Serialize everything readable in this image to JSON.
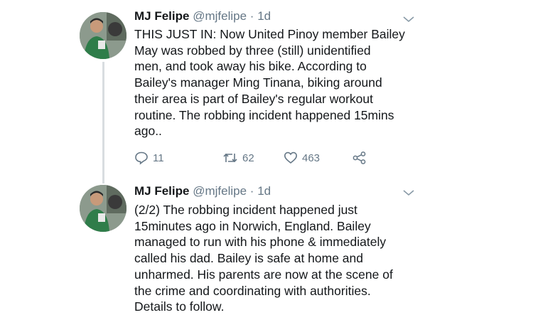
{
  "tweets": [
    {
      "author": {
        "name": "MJ Felipe",
        "handle": "@mjfelipe"
      },
      "separator": "·",
      "time": "1d",
      "text": "THIS JUST IN: Now United Pinoy member Bailey\nMay was robbed by three (still) unidentified\nmen, and took away his bike. According to\nBailey's manager Ming Tinana, biking around\ntheir area is part of Bailey's regular workout\nroutine. The robbing incident happened 15mins\nago..",
      "replies": "11",
      "retweets": "62",
      "likes": "463"
    },
    {
      "author": {
        "name": "MJ Felipe",
        "handle": "@mjfelipe"
      },
      "separator": "·",
      "time": "1d",
      "text": "(2/2) The robbing incident happened just\n15minutes ago in Norwich, England. Bailey\nmanaged to run with his phone & immediately\ncalled his dad. Bailey is safe at home and\nunharmed. His parents are now at the scene of\nthe crime and coordinating with authorities.\nDetails to follow."
    }
  ],
  "icons": {
    "reply": "reply-icon",
    "retweet": "retweet-icon",
    "like": "heart-icon",
    "share": "share-icon",
    "caret": "chevron-down-icon"
  },
  "colors": {
    "secondary_text": "#657786",
    "thread_line": "#d8dde0",
    "primary_text": "#14171a"
  }
}
